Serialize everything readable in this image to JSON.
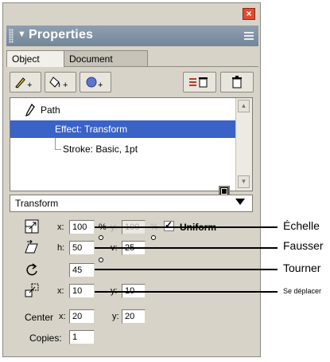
{
  "panel": {
    "title": "Properties",
    "tabs": [
      {
        "label": "Object",
        "active": true
      },
      {
        "label": "Document",
        "active": false
      }
    ]
  },
  "tree": {
    "items": [
      {
        "label": "Path",
        "selected": false
      },
      {
        "label": "Effect: Transform",
        "selected": true
      },
      {
        "label": "Stroke: Basic, 1pt",
        "selected": false
      }
    ]
  },
  "dropdown": {
    "selected": "Transform"
  },
  "transform": {
    "scale": {
      "x_label": "x:",
      "x_value": "100",
      "x_unit": "%",
      "y_label": "y:",
      "y_value": "100",
      "y_unit": "%",
      "uniform_label": "Uniform",
      "uniform_checked": true
    },
    "skew": {
      "h_label": "h:",
      "h_value": "50",
      "v_label": "v:",
      "v_value": "25"
    },
    "rotate": {
      "value": "45"
    },
    "move": {
      "x_label": "x:",
      "x_value": "10",
      "y_label": "y:",
      "y_value": "10"
    },
    "center": {
      "label": "Center",
      "x_label": "x:",
      "x_value": "20",
      "y_label": "y:",
      "y_value": "20"
    },
    "copies": {
      "label": "Copies:",
      "value": "1"
    }
  },
  "callouts": {
    "scale": "Échelle",
    "skew": "Fausser",
    "rotate": "Tourner",
    "move": "Se déplacer"
  },
  "colors": {
    "title_bar": "#7f91a3",
    "selection": "#3a62c7",
    "close": "#e24b2f",
    "panel_bg": "#d7d3c8"
  },
  "icons": [
    "close-icon",
    "panel-grip-icon",
    "collapse-arrow-icon",
    "panel-menu-icon",
    "add-stroke-icon",
    "add-fill-icon",
    "add-effect-icon",
    "delete-attribute-icon",
    "trash-icon",
    "pen-path-icon",
    "stroke-swatch",
    "scale-icon",
    "skew-icon",
    "rotate-icon",
    "move-icon",
    "scroll-up-icon",
    "scroll-down-icon"
  ]
}
